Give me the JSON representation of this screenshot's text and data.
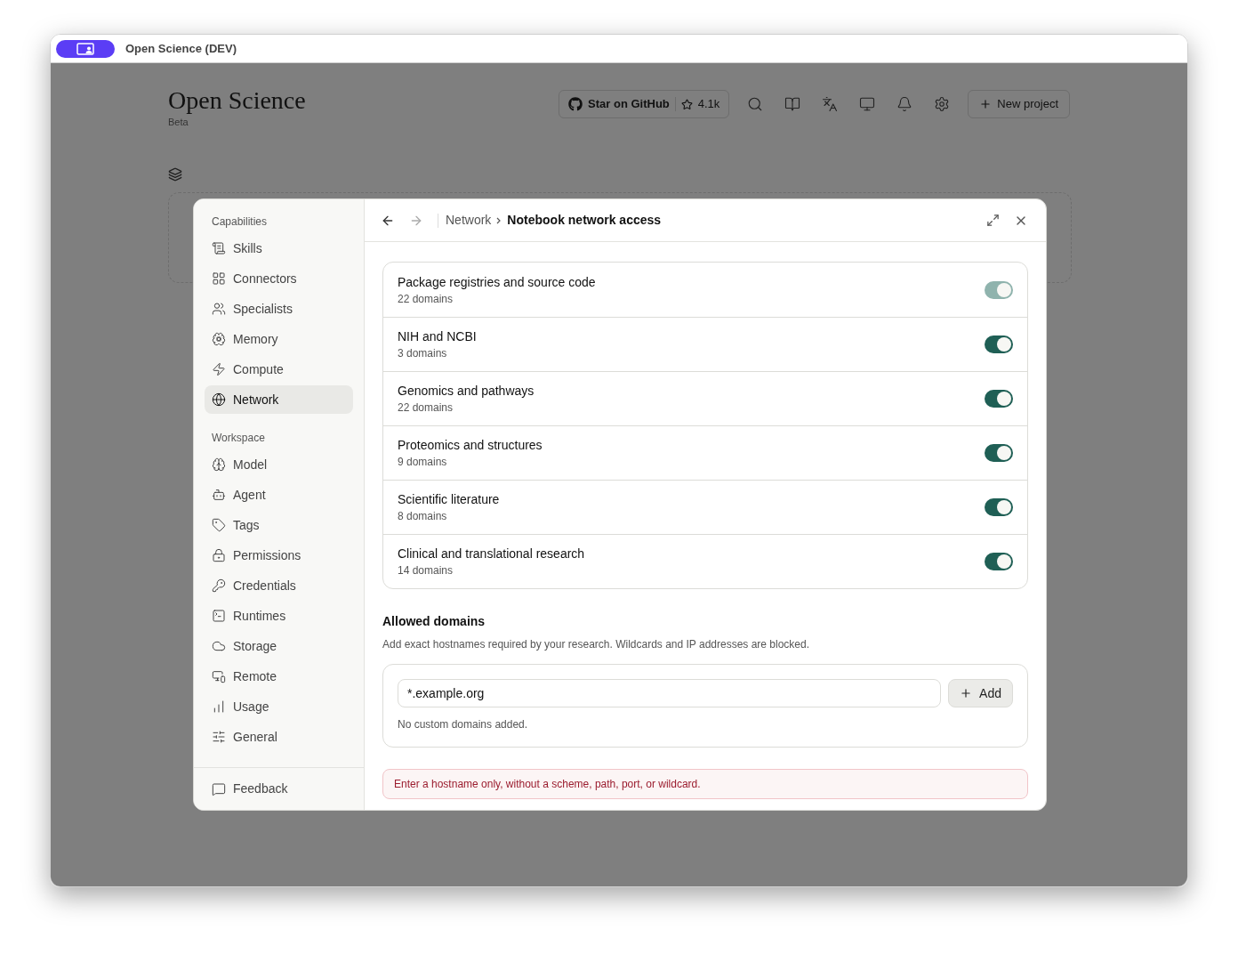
{
  "window": {
    "title": "Open Science (DEV)"
  },
  "header": {
    "title": "Open Science",
    "subtitle": "Beta",
    "github": {
      "label": "Star on GitHub",
      "stars": "4.1k"
    },
    "new_project": "New project"
  },
  "dialog": {
    "sidebar": {
      "sections": [
        {
          "title": "Capabilities",
          "items": [
            {
              "label": "Skills",
              "selected": false
            },
            {
              "label": "Connectors",
              "selected": false
            },
            {
              "label": "Specialists",
              "selected": false
            },
            {
              "label": "Memory",
              "selected": false
            },
            {
              "label": "Compute",
              "selected": false
            },
            {
              "label": "Network",
              "selected": true
            }
          ]
        },
        {
          "title": "Workspace",
          "items": [
            {
              "label": "Model",
              "selected": false
            },
            {
              "label": "Agent",
              "selected": false
            },
            {
              "label": "Tags",
              "selected": false
            },
            {
              "label": "Permissions",
              "selected": false
            },
            {
              "label": "Credentials",
              "selected": false
            },
            {
              "label": "Runtimes",
              "selected": false
            },
            {
              "label": "Storage",
              "selected": false
            },
            {
              "label": "Remote",
              "selected": false
            },
            {
              "label": "Usage",
              "selected": false
            },
            {
              "label": "General",
              "selected": false
            }
          ]
        }
      ],
      "footer": "Feedback"
    },
    "breadcrumb": [
      "Network",
      "Notebook network access"
    ],
    "groups": [
      {
        "name": "Package registries and source code",
        "count": "22 domains",
        "on": true,
        "disabled": true
      },
      {
        "name": "NIH and NCBI",
        "count": "3 domains",
        "on": true,
        "disabled": false
      },
      {
        "name": "Genomics and pathways",
        "count": "22 domains",
        "on": true,
        "disabled": false
      },
      {
        "name": "Proteomics and structures",
        "count": "9 domains",
        "on": true,
        "disabled": false
      },
      {
        "name": "Scientific literature",
        "count": "8 domains",
        "on": true,
        "disabled": false
      },
      {
        "name": "Clinical and translational research",
        "count": "14 domains",
        "on": true,
        "disabled": false
      }
    ],
    "allowed": {
      "title": "Allowed domains",
      "description": "Add exact hostnames required by your research. Wildcards and IP addresses are blocked.",
      "input_value": "*.example.org",
      "add_button": "Add",
      "empty": "No custom domains added."
    },
    "error": "Enter a hostname only, without a scheme, path, port, or wildcard."
  }
}
